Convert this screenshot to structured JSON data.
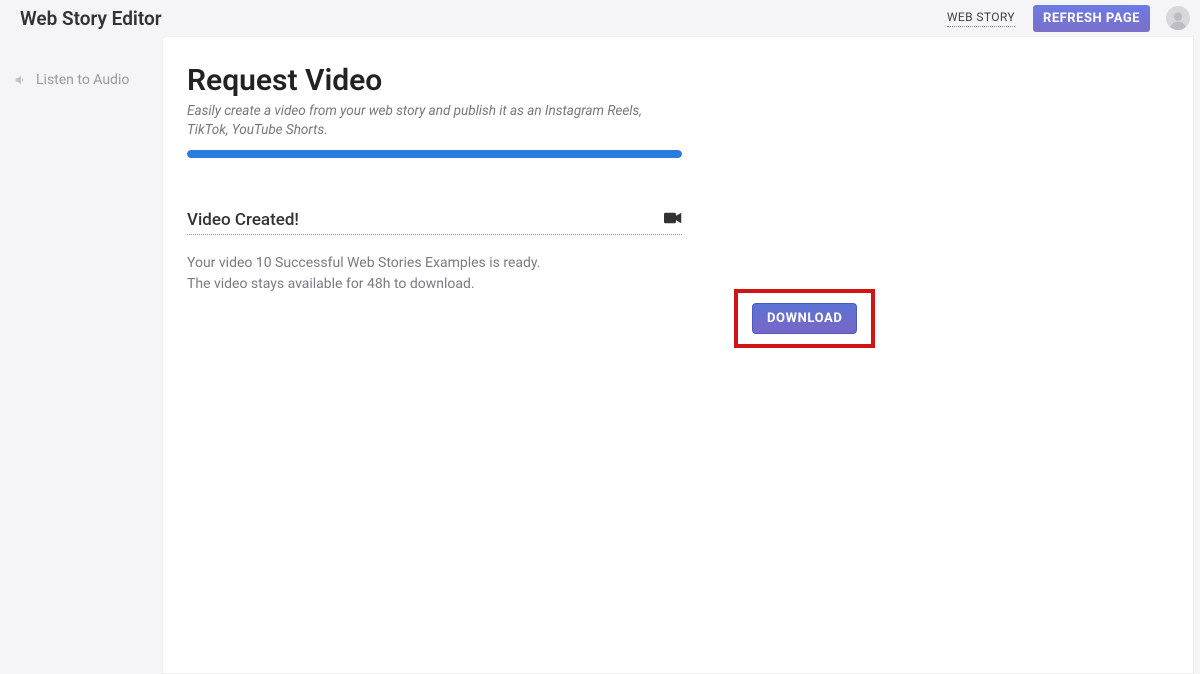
{
  "header": {
    "app_title": "Web Story Editor",
    "top_link": "WEB STORY",
    "refresh_label": "REFRESH PAGE"
  },
  "sidebar": {
    "items": [
      {
        "label": "Listen to Audio",
        "icon": "speaker-icon"
      }
    ]
  },
  "main": {
    "heading": "Request Video",
    "subheading": "Easily create a video from your web story and publish it as an Instagram Reels, TikTok, YouTube Shorts.",
    "progress_percent": 100,
    "section_title": "Video Created!",
    "status_line1": "Your video 10 Successful Web Stories Examples is ready.",
    "status_line2": "The video stays available for 48h to download.",
    "download_label": "DOWNLOAD"
  },
  "colors": {
    "highlight_border": "#d11313",
    "progress": "#2a7bde",
    "button_gradient_top": "#5a74d6",
    "button_gradient_bottom": "#7a66c5"
  }
}
